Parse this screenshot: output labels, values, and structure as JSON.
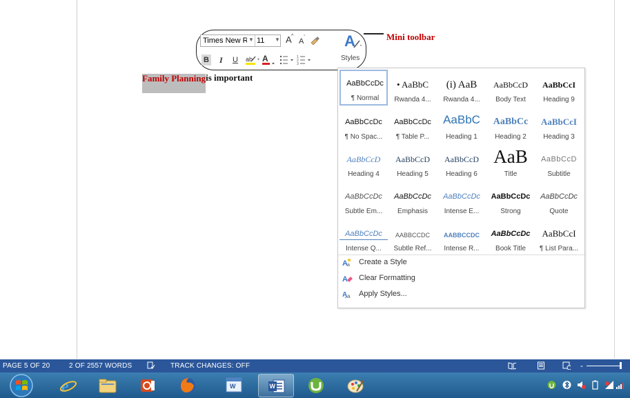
{
  "document": {
    "highlighted_text": "Family Planning",
    "rest_text": " is important"
  },
  "mini_toolbar": {
    "font_name": "Times New Roi",
    "font_size": "11",
    "grow_font": "A",
    "shrink_font": "A",
    "bold": "B",
    "italic": "I",
    "underline": "U",
    "font_color": "A",
    "styles_label": "Styles",
    "callout": "Mini toolbar"
  },
  "styles_gallery": {
    "tiles": [
      {
        "preview": "AaBbCcDc",
        "name": "¶ Normal"
      },
      {
        "preview": "• AaBbC",
        "name": "Rwanda 4..."
      },
      {
        "preview": "(i) AaB",
        "name": "Rwanda 4..."
      },
      {
        "preview": "AaBbCcD",
        "name": "Body Text"
      },
      {
        "preview": "AaBbCcI",
        "name": "Heading 9"
      },
      {
        "preview": "AaBbCcDc",
        "name": "¶ No Spac..."
      },
      {
        "preview": "AaBbCcDc",
        "name": "¶ Table P..."
      },
      {
        "preview": "AaBbC",
        "name": "Heading 1"
      },
      {
        "preview": "AaBbCc",
        "name": "Heading 2"
      },
      {
        "preview": "AaBbCcI",
        "name": "Heading 3"
      },
      {
        "preview": "AaBbCcD",
        "name": "Heading 4"
      },
      {
        "preview": "AaBbCcD",
        "name": "Heading 5"
      },
      {
        "preview": "AaBbCcD",
        "name": "Heading 6"
      },
      {
        "preview": "AaB",
        "name": "Title"
      },
      {
        "preview": "AaBbCcD",
        "name": "Subtitle"
      },
      {
        "preview": "AaBbCcDc",
        "name": "Subtle Em..."
      },
      {
        "preview": "AaBbCcDc",
        "name": "Emphasis"
      },
      {
        "preview": "AaBbCcDc",
        "name": "Intense E..."
      },
      {
        "preview": "AaBbCcDc",
        "name": "Strong"
      },
      {
        "preview": "AaBbCcDc",
        "name": "Quote"
      },
      {
        "preview": "AaBbCcDc",
        "name": "Intense Q..."
      },
      {
        "preview": "AABBCCDC",
        "name": "Subtle Ref..."
      },
      {
        "preview": "AABBCCDC",
        "name": "Intense R..."
      },
      {
        "preview": "AaBbCcDc",
        "name": "Book Title"
      },
      {
        "preview": "AaBbCcI",
        "name": "¶ List Para..."
      }
    ],
    "commands": [
      "Create a Style",
      "Clear Formatting",
      "Apply Styles..."
    ]
  },
  "status_bar": {
    "page": "PAGE 5 OF 20",
    "words": "2 OF 2557 WORDS",
    "track_changes": "TRACK CHANGES: OFF",
    "zoom_minus": "-",
    "colors": {
      "background": "#2b579a"
    }
  },
  "taskbar": {
    "items": [
      "windows-start",
      "internet-explorer",
      "file-explorer",
      "media-player",
      "firefox",
      "word-doc-icon",
      "microsoft-word",
      "utorrent",
      "paint"
    ],
    "colors": {
      "background": "#2a6aa0"
    }
  }
}
